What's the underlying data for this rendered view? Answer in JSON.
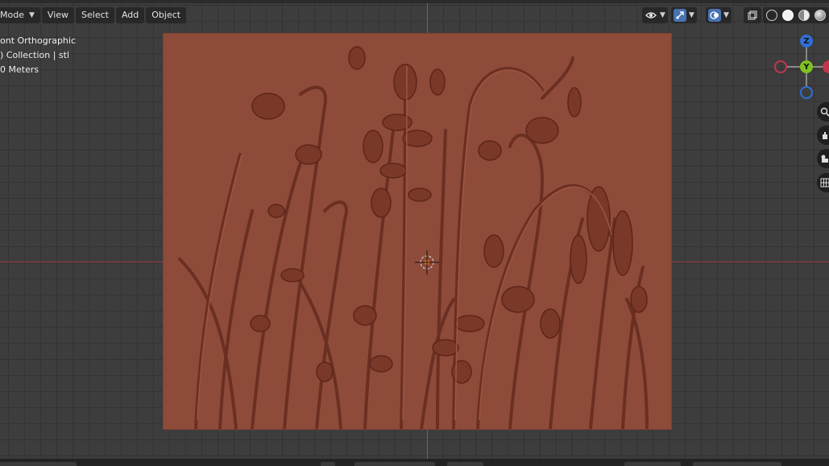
{
  "header": {
    "mode_label": "Mode",
    "menus": [
      "View",
      "Select",
      "Add",
      "Object"
    ]
  },
  "viewport_overlay": {
    "view_name": "ont Orthographic",
    "collection": ") Collection | stl",
    "scale": "0 Meters"
  },
  "gizmo": {
    "z_label": "Z",
    "y_label": "Y"
  },
  "colors": {
    "viewport_bg": "#3d3d3d",
    "x_axis": "#9c3d47",
    "z_axis": "#3e6da8",
    "relief": "#8e4b3a",
    "active_blue": "#4772b3"
  },
  "icons": [
    "eye-icon",
    "gizmo-toggle-icon",
    "overlay-icon",
    "xray-icon",
    "wireframe-shading-icon",
    "solid-shading-icon",
    "material-shading-icon",
    "rendered-shading-icon",
    "zoom-icon",
    "hand-pan-icon",
    "camera-icon",
    "grid-icon"
  ]
}
